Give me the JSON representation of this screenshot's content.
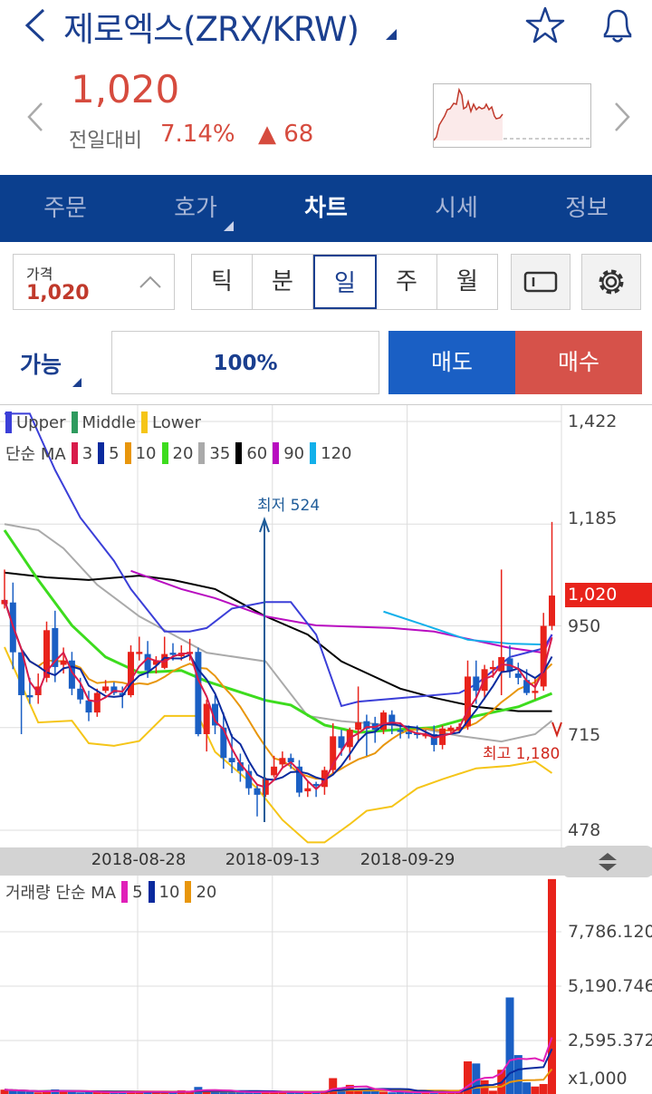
{
  "header": {
    "title": "제로엑스(ZRX/KRW)",
    "back_icon": "chevron-left-icon",
    "star_icon": "star-icon",
    "bell_icon": "bell-icon"
  },
  "quote": {
    "price": "1,020",
    "compare_label": "전일대비",
    "change_pct": "7.14%",
    "change_value": "▲ 68"
  },
  "tabs": [
    {
      "label": "주문"
    },
    {
      "label": "호가"
    },
    {
      "label": "차트"
    },
    {
      "label": "시세"
    },
    {
      "label": "정보"
    }
  ],
  "controls": {
    "price_label": "가격",
    "price_value": "1,020",
    "periods": [
      "틱",
      "분",
      "일",
      "주",
      "월"
    ],
    "selected_period": "일"
  },
  "order": {
    "avail_label": "가능",
    "percent": "100%",
    "sell_label": "매도",
    "buy_label": "매수"
  },
  "colors": {
    "up": "#e8231b",
    "down": "#1a5fc4",
    "navy": "#0b3f8e"
  },
  "chart_data": {
    "type": "candlestick",
    "bollinger_legend": [
      {
        "name": "Upper",
        "color": "#3b3fd8"
      },
      {
        "name": "Middle",
        "color": "#2e9a5e"
      },
      {
        "name": "Lower",
        "color": "#f5c518"
      }
    ],
    "ma_label": "단순 MA",
    "ma_legend": [
      {
        "name": "3",
        "color": "#d81b4a"
      },
      {
        "name": "5",
        "color": "#0a2a9e"
      },
      {
        "name": "10",
        "color": "#e8960c"
      },
      {
        "name": "20",
        "color": "#3ddc1e"
      },
      {
        "name": "35",
        "color": "#aaaaaa"
      },
      {
        "name": "60",
        "color": "#000000"
      },
      {
        "name": "90",
        "color": "#b80cc0"
      },
      {
        "name": "120",
        "color": "#12b0ea"
      }
    ],
    "y_ticks": [
      "1,422",
      "1,185",
      "950",
      "715",
      "478"
    ],
    "y_tick_values": [
      1422,
      1185,
      950,
      715,
      478
    ],
    "x_ticks": [
      "2018-08-28",
      "2018-09-13",
      "2018-09-29"
    ],
    "x_tick_index": [
      16,
      32,
      48
    ],
    "current_price_tag": "1,020",
    "low_annotation": "최저 524",
    "high_annotation": "최고 1,180",
    "candles": [
      [
        1000,
        1080,
        990,
        1010
      ],
      [
        1004,
        1050,
        850,
        889
      ],
      [
        889,
        840,
        700,
        790
      ],
      [
        790,
        830,
        770,
        785
      ],
      [
        790,
        840,
        770,
        810
      ],
      [
        830,
        960,
        820,
        940
      ],
      [
        945,
        985,
        820,
        855
      ],
      [
        860,
        900,
        840,
        870
      ],
      [
        870,
        890,
        790,
        805
      ],
      [
        805,
        830,
        770,
        780
      ],
      [
        778,
        800,
        730,
        750
      ],
      [
        750,
        805,
        740,
        795
      ],
      [
        800,
        825,
        795,
        810
      ],
      [
        810,
        820,
        790,
        795
      ],
      [
        795,
        810,
        760,
        790
      ],
      [
        790,
        905,
        785,
        890
      ],
      [
        885,
        925,
        870,
        890
      ],
      [
        885,
        915,
        830,
        847
      ],
      [
        860,
        880,
        840,
        870
      ],
      [
        853,
        925,
        850,
        885
      ],
      [
        888,
        910,
        870,
        883
      ],
      [
        880,
        905,
        870,
        888
      ],
      [
        885,
        920,
        870,
        890
      ],
      [
        890,
        900,
        695,
        700
      ],
      [
        700,
        780,
        660,
        770
      ],
      [
        770,
        790,
        700,
        720
      ],
      [
        715,
        750,
        620,
        645
      ],
      [
        645,
        700,
        610,
        635
      ],
      [
        635,
        655,
        590,
        615
      ],
      [
        615,
        630,
        560,
        575
      ],
      [
        575,
        585,
        510,
        560
      ],
      [
        560,
        600,
        555,
        597
      ],
      [
        605,
        650,
        600,
        625
      ],
      [
        630,
        660,
        620,
        645
      ],
      [
        645,
        655,
        620,
        635
      ],
      [
        625,
        640,
        555,
        565
      ],
      [
        568,
        590,
        555,
        575
      ],
      [
        585,
        590,
        555,
        580
      ],
      [
        578,
        625,
        560,
        617
      ],
      [
        617,
        725,
        610,
        695
      ],
      [
        695,
        710,
        650,
        668
      ],
      [
        670,
        715,
        640,
        710
      ],
      [
        710,
        810,
        680,
        727
      ],
      [
        730,
        745,
        650,
        712
      ],
      [
        725,
        740,
        680,
        710
      ],
      [
        710,
        755,
        700,
        750
      ],
      [
        745,
        755,
        700,
        720
      ],
      [
        710,
        725,
        690,
        705
      ],
      [
        705,
        720,
        690,
        700
      ],
      [
        702,
        720,
        690,
        700
      ],
      [
        695,
        710,
        690,
        700
      ],
      [
        700,
        720,
        660,
        675
      ],
      [
        675,
        720,
        665,
        713
      ],
      [
        708,
        720,
        700,
        715
      ],
      [
        712,
        725,
        705,
        717
      ],
      [
        718,
        870,
        710,
        833
      ],
      [
        833,
        870,
        770,
        800
      ],
      [
        800,
        860,
        780,
        850
      ],
      [
        850,
        870,
        830,
        855
      ],
      [
        845,
        1080,
        790,
        878
      ],
      [
        875,
        905,
        830,
        845
      ],
      [
        840,
        865,
        815,
        830
      ],
      [
        825,
        850,
        790,
        795
      ],
      [
        795,
        830,
        780,
        800
      ],
      [
        810,
        980,
        800,
        950
      ],
      [
        950,
        1190,
        940,
        1020
      ]
    ],
    "upper": [
      [
        0,
        1440
      ],
      [
        3,
        1440
      ],
      [
        6,
        1310
      ],
      [
        9,
        1200
      ],
      [
        13,
        1100
      ],
      [
        15,
        1035
      ],
      [
        19,
        937
      ],
      [
        22,
        937
      ],
      [
        24,
        945
      ],
      [
        27,
        990
      ],
      [
        31,
        1005
      ],
      [
        34,
        1005
      ],
      [
        37,
        930
      ],
      [
        40,
        765
      ],
      [
        42,
        775
      ],
      [
        48,
        785
      ],
      [
        54,
        795
      ],
      [
        56,
        815
      ],
      [
        60,
        878
      ],
      [
        64,
        898
      ],
      [
        65,
        930
      ]
    ],
    "middle": [
      [
        0,
        1171
      ],
      [
        4,
        1056
      ],
      [
        8,
        951
      ],
      [
        12,
        878
      ],
      [
        16,
        842
      ],
      [
        21,
        847
      ],
      [
        24,
        822
      ],
      [
        31,
        778
      ],
      [
        34,
        767
      ],
      [
        38,
        721
      ],
      [
        42,
        704
      ],
      [
        47,
        711
      ],
      [
        51,
        715
      ],
      [
        56,
        742
      ],
      [
        61,
        763
      ],
      [
        65,
        794
      ]
    ],
    "lower": [
      [
        0,
        901
      ],
      [
        4,
        727
      ],
      [
        8,
        731
      ],
      [
        10,
        679
      ],
      [
        13,
        673
      ],
      [
        16,
        684
      ],
      [
        19,
        742
      ],
      [
        23,
        742
      ],
      [
        25,
        659
      ],
      [
        30,
        575
      ],
      [
        33,
        502
      ],
      [
        36,
        450
      ],
      [
        38,
        450
      ],
      [
        41,
        492
      ],
      [
        43,
        523
      ],
      [
        46,
        533
      ],
      [
        49,
        575
      ],
      [
        52,
        596
      ],
      [
        56,
        621
      ],
      [
        60,
        627
      ],
      [
        63,
        637
      ],
      [
        65,
        610
      ]
    ],
    "ma35": [
      [
        0,
        1185
      ],
      [
        4,
        1171
      ],
      [
        7,
        1129
      ],
      [
        11,
        1045
      ],
      [
        16,
        972
      ],
      [
        20,
        930
      ],
      [
        24,
        888
      ],
      [
        31,
        868
      ],
      [
        36,
        742
      ],
      [
        40,
        730
      ],
      [
        46,
        721
      ],
      [
        50,
        711
      ],
      [
        54,
        696
      ],
      [
        59,
        683
      ],
      [
        63,
        700
      ],
      [
        65,
        731
      ]
    ],
    "ma60": [
      [
        0,
        1073
      ],
      [
        5,
        1062
      ],
      [
        10,
        1056
      ],
      [
        16,
        1066
      ],
      [
        20,
        1056
      ],
      [
        25,
        1035
      ],
      [
        31,
        972
      ],
      [
        36,
        930
      ],
      [
        40,
        868
      ],
      [
        47,
        805
      ],
      [
        51,
        784
      ],
      [
        56,
        763
      ],
      [
        61,
        753
      ],
      [
        65,
        753
      ]
    ],
    "ma90": [
      [
        15,
        1077
      ],
      [
        21,
        1035
      ],
      [
        25,
        1014
      ],
      [
        31,
        972
      ],
      [
        37,
        951
      ],
      [
        46,
        945
      ],
      [
        51,
        937
      ],
      [
        55,
        920
      ],
      [
        60,
        899
      ],
      [
        64,
        888
      ],
      [
        65,
        930
      ]
    ],
    "ma120": [
      [
        45,
        983
      ],
      [
        50,
        951
      ],
      [
        55,
        918
      ],
      [
        60,
        909
      ],
      [
        64,
        907
      ]
    ],
    "ylim": [
      478,
      1422
    ],
    "volume": {
      "label": "거래량 단순 MA",
      "ma_legend": [
        {
          "name": "5",
          "color": "#e020b8"
        },
        {
          "name": "10",
          "color": "#0a2a9e"
        },
        {
          "name": "20",
          "color": "#e8960c"
        }
      ],
      "y_ticks": [
        "7,786.120",
        "5,190.746",
        "2,595.372"
      ],
      "y_tick_values": [
        7786.12,
        5190.746,
        2595.372
      ],
      "unit": "x1,000",
      "values": [
        250,
        200,
        180,
        150,
        120,
        200,
        260,
        200,
        150,
        120,
        150,
        130,
        120,
        100,
        150,
        200,
        140,
        160,
        120,
        100,
        150,
        220,
        180,
        380,
        200,
        170,
        150,
        140,
        130,
        120,
        140,
        160,
        150,
        130,
        110,
        120,
        150,
        140,
        200,
        800,
        300,
        480,
        200,
        250,
        180,
        150,
        120,
        130,
        110,
        100,
        150,
        140,
        120,
        100,
        150,
        1600,
        1500,
        700,
        200,
        1200,
        4650,
        1900,
        600,
        400,
        520,
        10300
      ]
    }
  }
}
